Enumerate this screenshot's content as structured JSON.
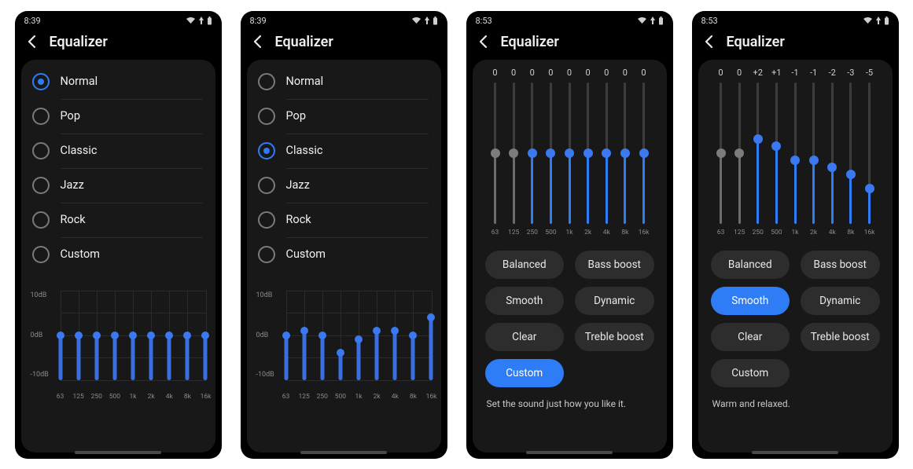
{
  "status": {
    "time1": "8:39",
    "time2": "8:39",
    "time3": "8:53",
    "time4": "8:53"
  },
  "header": {
    "title": "Equalizer"
  },
  "freqs": [
    "63",
    "125",
    "250",
    "500",
    "1k",
    "2k",
    "4k",
    "8k",
    "16k"
  ],
  "yticks": [
    "10dB",
    "0dB",
    "-10dB"
  ],
  "presets": {
    "items": [
      "Normal",
      "Pop",
      "Classic",
      "Jazz",
      "Rock",
      "Custom"
    ],
    "selected_screen1": 0,
    "selected_screen2": 2
  },
  "chart_data": [
    {
      "type": "bar",
      "title": "Equalizer — Normal",
      "categories": [
        "63",
        "125",
        "250",
        "500",
        "1k",
        "2k",
        "4k",
        "8k",
        "16k"
      ],
      "values": [
        0,
        0,
        0,
        0,
        0,
        0,
        0,
        0,
        0
      ],
      "ylabel": "dB",
      "ylim": [
        -10,
        10
      ]
    },
    {
      "type": "bar",
      "title": "Equalizer — Classic",
      "categories": [
        "63",
        "125",
        "250",
        "500",
        "1k",
        "2k",
        "4k",
        "8k",
        "16k"
      ],
      "values": [
        0,
        1,
        0,
        -4,
        -1,
        1,
        1,
        0,
        4
      ],
      "ylabel": "dB",
      "ylim": [
        -10,
        10
      ]
    },
    {
      "type": "bar",
      "title": "Equalizer — Custom (flat)",
      "categories": [
        "63",
        "125",
        "250",
        "500",
        "1k",
        "2k",
        "4k",
        "8k",
        "16k"
      ],
      "values": [
        0,
        0,
        0,
        0,
        0,
        0,
        0,
        0,
        0
      ],
      "ylabel": "dB",
      "ylim": [
        -10,
        10
      ]
    },
    {
      "type": "bar",
      "title": "Equalizer — Smooth",
      "categories": [
        "63",
        "125",
        "250",
        "500",
        "1k",
        "2k",
        "4k",
        "8k",
        "16k"
      ],
      "values": [
        0,
        0,
        2,
        1,
        -1,
        -1,
        -2,
        -3,
        -5
      ],
      "ylabel": "dB",
      "ylim": [
        -10,
        10
      ]
    }
  ],
  "custom": {
    "chips": [
      "Balanced",
      "Bass boost",
      "Smooth",
      "Dynamic",
      "Clear",
      "Treble boost",
      "Custom"
    ],
    "selected_screen3": 6,
    "selected_screen4": 2,
    "desc3": "Set the sound just how you like it.",
    "desc4": "Warm and relaxed."
  },
  "colors": {
    "accent": "#2e7cf6"
  }
}
